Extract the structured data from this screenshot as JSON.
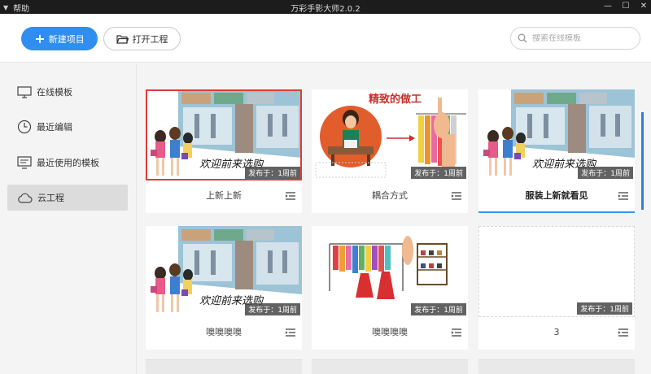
{
  "titlebar": {
    "menu_label": "帮助",
    "app_title": "万彩手影大师2.0.2",
    "min_label": "—",
    "max_label": "☐",
    "close_label": "✕"
  },
  "toolbar": {
    "new_project": "新建项目",
    "open_project": "打开工程",
    "search_placeholder": "搜索在线模板"
  },
  "sidebar": {
    "items": [
      {
        "label": "在线模板",
        "icon": "monitor-icon"
      },
      {
        "label": "最近编辑",
        "icon": "clock-icon"
      },
      {
        "label": "最近使用的模板",
        "icon": "monitor-list-icon"
      },
      {
        "label": "云工程",
        "icon": "cloud-icon"
      }
    ],
    "active_index": 3
  },
  "projects": [
    {
      "name": "上新上新",
      "badge": "发布于：1周前",
      "thumb": "shopping-street",
      "overlay_text": "欢迎前来选购"
    },
    {
      "name": "耦合方式",
      "badge": "发布于：1周前",
      "thumb": "tailor",
      "overlay_text": "精致的做工"
    },
    {
      "name": "服装上新就看见",
      "badge": "发布于：1周前",
      "thumb": "shopping-street",
      "overlay_text": "欢迎前来选购"
    },
    {
      "name": "噢噢噢噢",
      "badge": "发布于：1周前",
      "thumb": "shopping-street",
      "overlay_text": "欢迎前来选购"
    },
    {
      "name": "噢噢噢噢",
      "badge": "发布于：1周前",
      "thumb": "clothes-rack",
      "overlay_text": ""
    },
    {
      "name": "3",
      "badge": "发布于：1周前",
      "thumb": "empty",
      "overlay_text": ""
    }
  ],
  "colors": {
    "accent": "#2f8ef0",
    "selected": "#e03a3a",
    "titlebar": "#1c1c1c"
  }
}
